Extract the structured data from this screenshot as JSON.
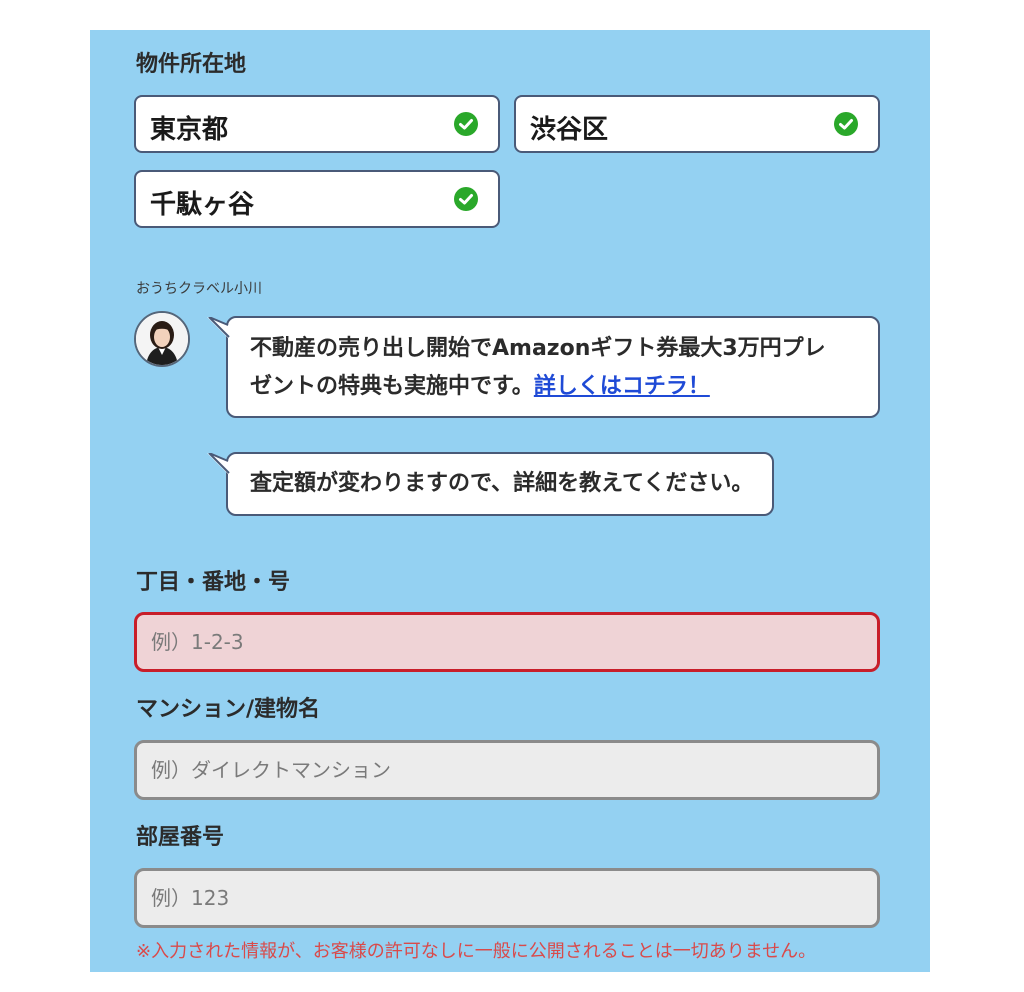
{
  "location_section": {
    "label": "物件所在地",
    "prefecture": "東京都",
    "city": "渋谷区",
    "town": "千駄ヶ谷"
  },
  "operator": {
    "name": "おうちクラベル小川"
  },
  "messages": {
    "promo_line1": "不動産の売り出し開始でAmazonギフト券最大3万円プレ",
    "promo_line2": "ゼントの特典も実施中です。",
    "promo_link": "詳しくはコチラ！",
    "prompt": "査定額が変わりますので、詳細を教えてください。"
  },
  "fields": {
    "address_number": {
      "label": "丁目・番地・号",
      "placeholder": "例）1-2-3",
      "value": ""
    },
    "building": {
      "label": "マンション/建物名",
      "placeholder": "例）ダイレクトマンション",
      "value": ""
    },
    "room": {
      "label": "部屋番号",
      "placeholder": "例）123",
      "value": ""
    }
  },
  "notice": "※入力された情報が、お客様の許可なしに一般に公開されることは一切ありません。",
  "colors": {
    "panel_bg": "#94d1f2",
    "check_green": "#2aa82a",
    "error_border": "#c81e2a",
    "error_bg": "#efd3d6",
    "link_blue": "#1f4ad6",
    "notice_red": "#d94a4a"
  },
  "icons": {
    "check": "check-circle-icon",
    "avatar": "operator-avatar"
  }
}
